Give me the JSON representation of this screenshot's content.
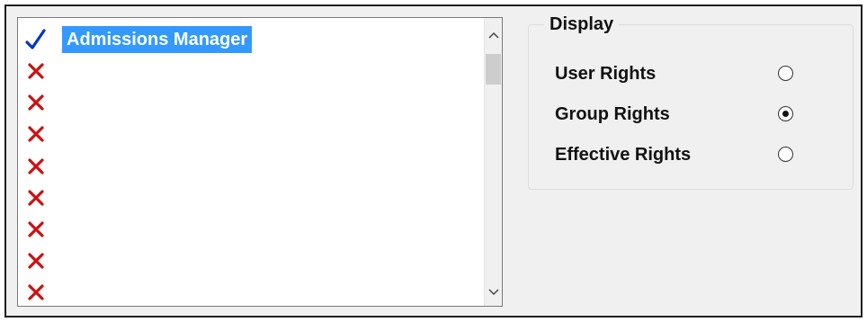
{
  "list": {
    "items": [
      {
        "label": "Admissions Manager",
        "status": "check-icon",
        "selected": true
      },
      {
        "label": "",
        "status": "cross-icon",
        "selected": false
      },
      {
        "label": "",
        "status": "cross-icon",
        "selected": false
      },
      {
        "label": "",
        "status": "cross-icon",
        "selected": false
      },
      {
        "label": "",
        "status": "cross-icon",
        "selected": false
      },
      {
        "label": "",
        "status": "cross-icon",
        "selected": false
      },
      {
        "label": "",
        "status": "cross-icon",
        "selected": false
      },
      {
        "label": "",
        "status": "cross-icon",
        "selected": false
      },
      {
        "label": "",
        "status": "cross-icon",
        "selected": false
      }
    ]
  },
  "display": {
    "legend": "Display",
    "options": [
      {
        "label": "User Rights",
        "checked": false
      },
      {
        "label": "Group Rights",
        "checked": true
      },
      {
        "label": "Effective Rights",
        "checked": false
      }
    ]
  },
  "colors": {
    "check": "#0033cc",
    "cross": "#cc1111",
    "selection": "#3399ff"
  }
}
